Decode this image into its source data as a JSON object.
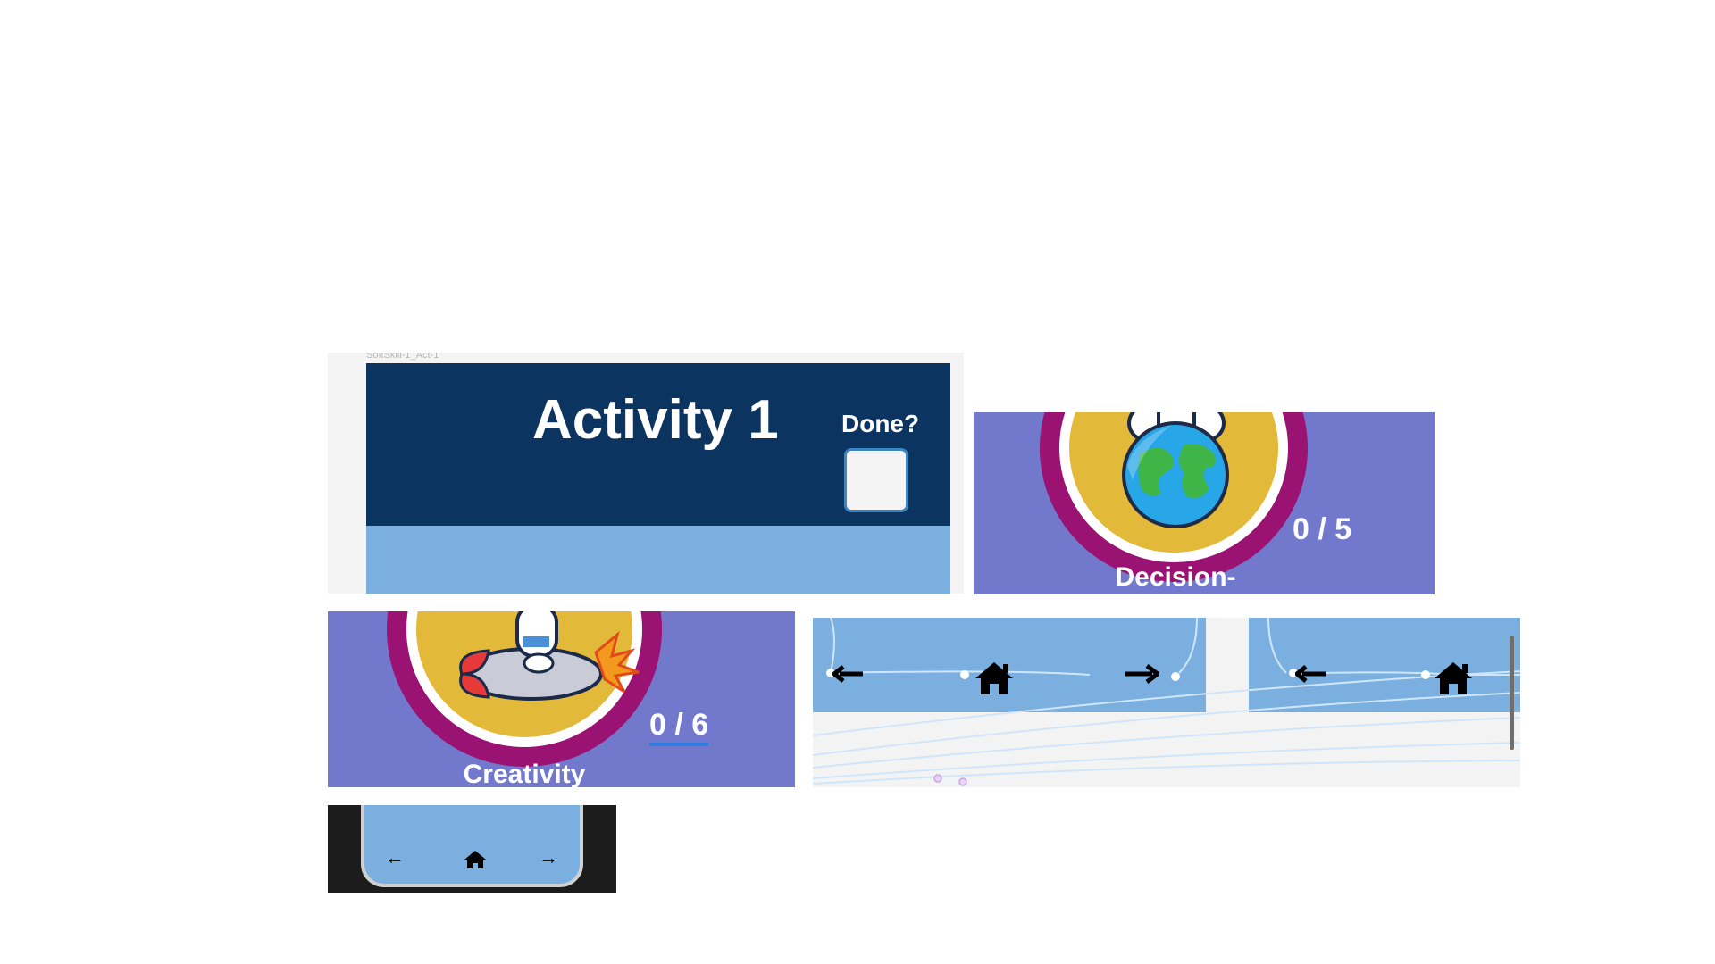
{
  "activity_panel": {
    "frame_label": "SoftSkill-1_Act-1",
    "title": "Activity 1",
    "done_label": "Done?"
  },
  "badges": [
    {
      "skill": "Decision-",
      "count": "0 / 5",
      "illustration": "astronaut-earth-icon"
    },
    {
      "skill": "Creativity",
      "count": "0 / 6",
      "illustration": "astronaut-rocket-icon"
    }
  ],
  "nav": {
    "icons": [
      "arrow-left-icon",
      "home-icon",
      "arrow-right-icon"
    ],
    "glyphs": {
      "back": "←",
      "home": "⌂",
      "forward": "→"
    }
  },
  "colors": {
    "header_navy": "#0b3461",
    "light_blue": "#7aafe0",
    "badge_purple": "#7279cd",
    "ring_magenta": "#9a1272",
    "disc_gold": "#e3b93a",
    "phone_frame": "#1c1c1c"
  }
}
